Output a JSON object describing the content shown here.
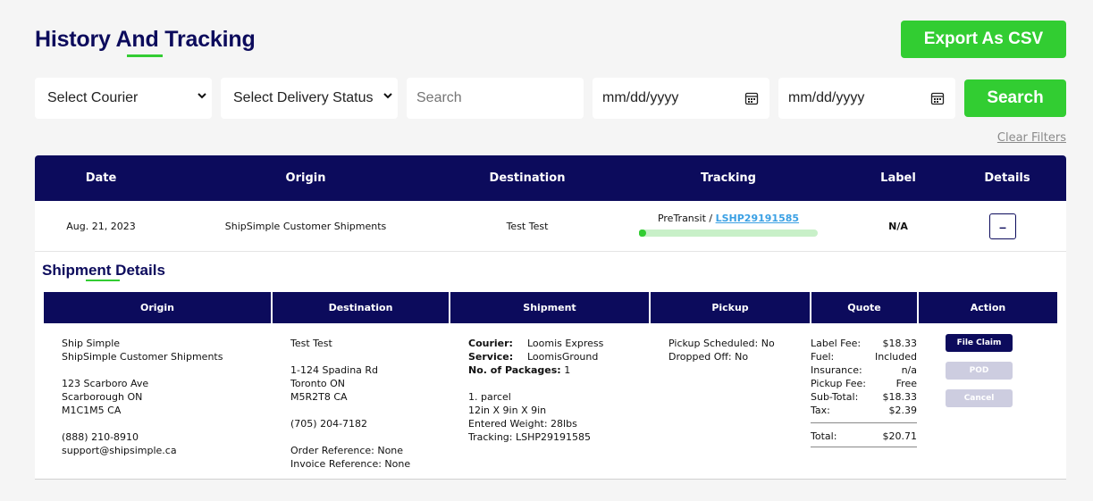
{
  "page": {
    "title": "History And Tracking",
    "export_label": "Export As CSV"
  },
  "filters": {
    "courier": "Select Courier",
    "delivery_status": "Select Delivery Status",
    "search_placeholder": "Search",
    "date_from_placeholder": "mm/dd/yyyy",
    "date_to_placeholder": "mm/dd/yyyy",
    "search_button": "Search",
    "clear_filters": "Clear Filters"
  },
  "table": {
    "headers": [
      "Date",
      "Origin",
      "Destination",
      "Tracking",
      "Label",
      "Details"
    ],
    "row": {
      "date": "Aug. 21, 2023",
      "origin": "ShipSimple Customer Shipments",
      "destination": "Test Test",
      "tracking_status": "PreTransit /",
      "tracking_number": "LSHP29191585",
      "tracking_progress": 0.03,
      "label": "N/A",
      "toggle": "–"
    }
  },
  "details": {
    "title": "Shipment Details",
    "headers": [
      "Origin",
      "Destination",
      "Shipment",
      "Pickup",
      "Quote",
      "Action"
    ],
    "origin": {
      "name": "Ship Simple",
      "company": "ShipSimple Customer Shipments",
      "street": "123 Scarboro Ave",
      "city": "Scarborough ON",
      "postal": "M1C1M5 CA",
      "phone": "(888) 210-8910",
      "email": "support@shipsimple.ca"
    },
    "destination": {
      "name": "Test Test",
      "street": "1-124 Spadina Rd",
      "city": "Toronto ON",
      "postal": "M5R2T8 CA",
      "phone": "(705) 204-7182",
      "order_ref": "Order Reference: None",
      "invoice_ref": "Invoice Reference: None"
    },
    "shipment": {
      "courier_label": "Courier:",
      "courier": "Loomis Express",
      "service_label": "Service:",
      "service": "LoomisGround",
      "packages_label": "No. of Packages:",
      "packages": "1",
      "parcel": "1. parcel",
      "dims": "12in X 9in X 9in",
      "weight": "Entered Weight: 28lbs",
      "tracking": "Tracking: LSHP29191585"
    },
    "pickup": {
      "scheduled": "Pickup Scheduled: No",
      "dropped": "Dropped Off: No"
    },
    "quote": {
      "rows": [
        {
          "label": "Label Fee:",
          "value": "$18.33"
        },
        {
          "label": "Fuel:",
          "value": "Included"
        },
        {
          "label": "Insurance:",
          "value": "n/a"
        },
        {
          "label": "Pickup Fee:",
          "value": "Free"
        },
        {
          "label": "Sub-Total:",
          "value": "$18.33"
        },
        {
          "label": "Tax:",
          "value": "$2.39"
        }
      ],
      "total_label": "Total:",
      "total_value": "$20.71"
    },
    "actions": {
      "file_claim": "File Claim",
      "pod": "POD",
      "cancel": "Cancel"
    }
  },
  "colors": {
    "navy": "#0c0b5c",
    "green": "#32cd32",
    "link": "#3aa0e4"
  }
}
